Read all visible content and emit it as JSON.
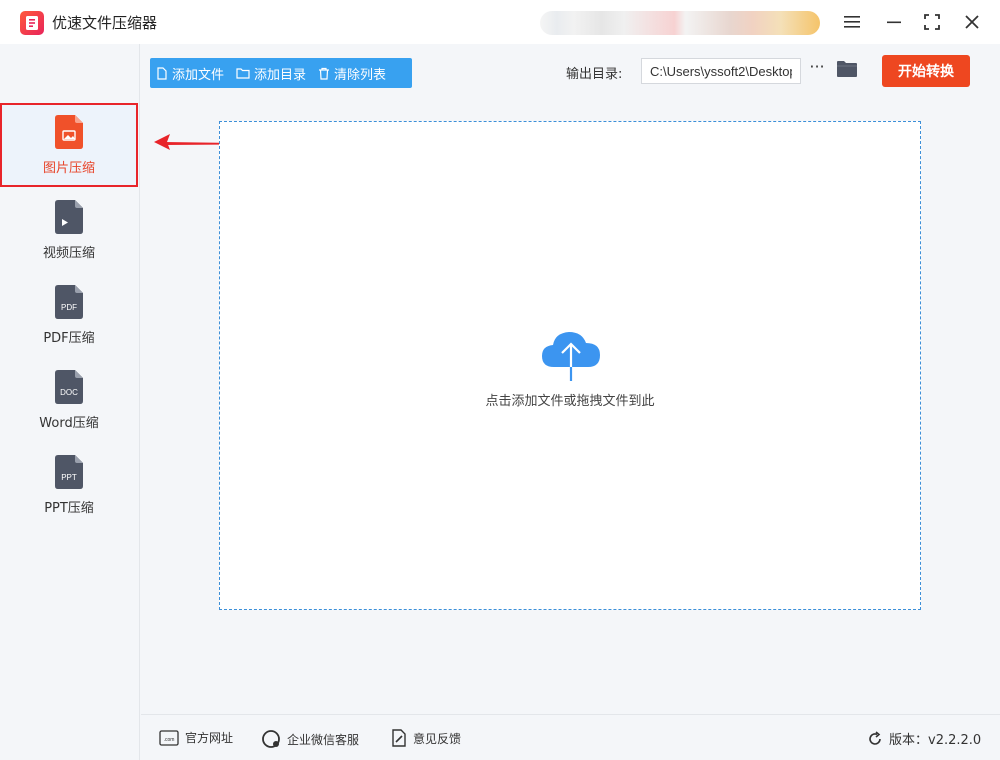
{
  "app": {
    "title": "优速文件压缩器",
    "window_controls": [
      "menu-icon",
      "maximize-icon",
      "close-icon"
    ]
  },
  "sidebar": {
    "items": [
      {
        "label": "图片压缩",
        "icon": "image-file-icon",
        "active": true
      },
      {
        "label": "视频压缩",
        "icon": "video-file-icon",
        "active": false
      },
      {
        "label": "PDF压缩",
        "icon": "pdf-file-icon",
        "icon_text": "PDF",
        "active": false
      },
      {
        "label": "Word压缩",
        "icon": "doc-file-icon",
        "icon_text": "DOC",
        "active": false
      },
      {
        "label": "PPT压缩",
        "icon": "ppt-file-icon",
        "icon_text": "PPT",
        "active": false
      }
    ]
  },
  "toolbar": {
    "add_file": "添加文件",
    "add_folder": "添加目录",
    "clear_list": "清除列表",
    "output_label": "输出目录:",
    "output_path": "C:\\Users\\yssoft2\\Desktop",
    "more": "···",
    "start": "开始转换"
  },
  "dropzone": {
    "hint": "点击添加文件或拖拽文件到此"
  },
  "footer": {
    "website": "官方网址",
    "wechat": "企业微信客服",
    "feedback": "意见反馈",
    "version": "版本：v2.2.2.0"
  },
  "colors": {
    "accent_blue": "#38a1f0",
    "start_orange": "#ee4720",
    "active_red": "#e8242a",
    "icon_orange": "#f0512a",
    "icon_gray": "#4f5666"
  }
}
